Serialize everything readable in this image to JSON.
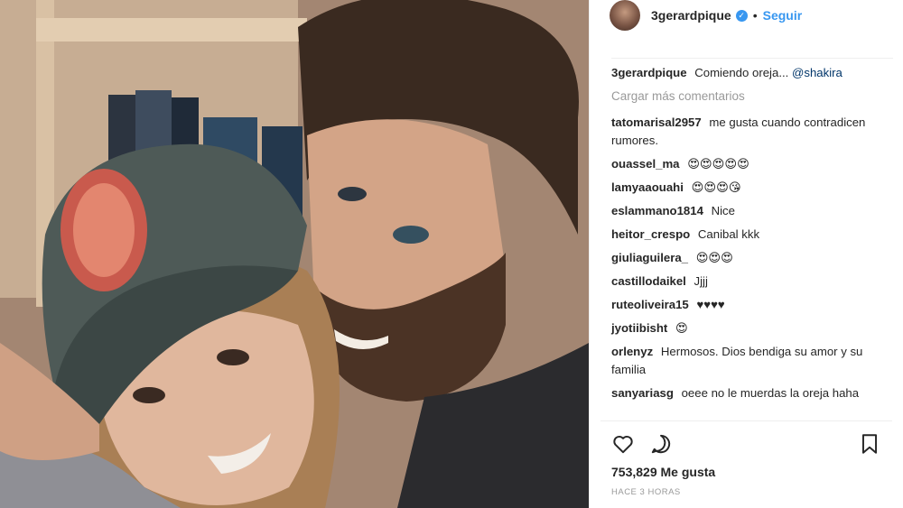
{
  "header": {
    "username": "3gerardpique",
    "verified_icon": "verified-badge-icon",
    "separator": "•",
    "follow_label": "Seguir"
  },
  "caption": {
    "username": "3gerardpique",
    "text": "Comiendo oreja...",
    "mention": "@shakira"
  },
  "load_more_label": "Cargar más comentarios",
  "comments": [
    {
      "user": "tatomarisal2957",
      "text": "me gusta cuando contradicen rumores."
    },
    {
      "user": "ouassel_ma",
      "text": "😍😍😍😍😍"
    },
    {
      "user": "lamyaaouahi",
      "text": "😍😍😍😘"
    },
    {
      "user": "eslammano1814",
      "text": "Nice"
    },
    {
      "user": "heitor_crespo",
      "text": "Canibal kkk"
    },
    {
      "user": "giuliaguilera_",
      "text": "😍😍😍"
    },
    {
      "user": "castillodaikel",
      "text": "Jjjj"
    },
    {
      "user": "ruteoliveira15",
      "text": "♥♥♥♥"
    },
    {
      "user": "jyotiibisht",
      "text": "😍"
    },
    {
      "user": "orlenyz",
      "text": "Hermosos. Dios bendiga su amor y su familia"
    },
    {
      "user": "sanyariasg",
      "text": "oeee no le muerdas la oreja haha"
    }
  ],
  "actions": {
    "like_icon": "heart-icon",
    "comment_icon": "comment-icon",
    "save_icon": "bookmark-icon"
  },
  "likes": "753,829 Me gusta",
  "timestamp": "HACE 3 HORAS",
  "colors": {
    "accent": "#3897f0",
    "text": "#262626",
    "muted": "#999999",
    "mention": "#003569"
  }
}
